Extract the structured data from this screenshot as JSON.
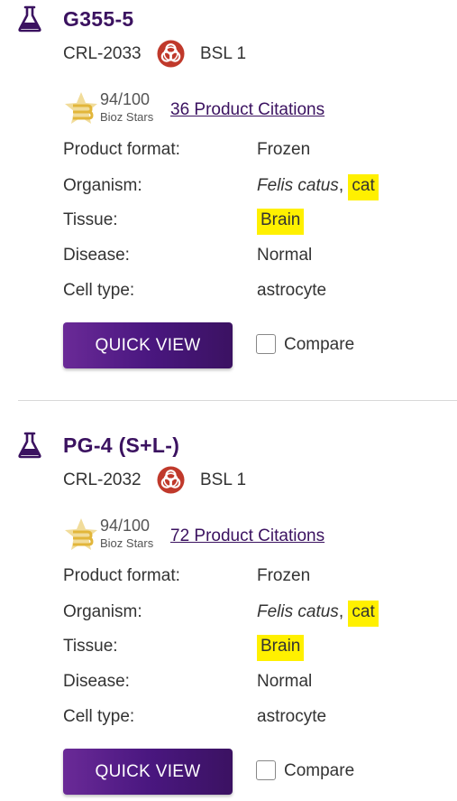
{
  "products": [
    {
      "name": "G355-5",
      "catalog": "CRL-2033",
      "biosafety": "BSL 1",
      "score": "94/100",
      "score_label": "Bioz Stars",
      "citations": "36 Product Citations",
      "properties": {
        "format_label": "Product format:",
        "format_value": "Frozen",
        "organism_label": "Organism:",
        "organism_species": "Felis catus",
        "organism_sep": ",",
        "organism_common": "cat",
        "tissue_label": "Tissue:",
        "tissue_value": "Brain",
        "disease_label": "Disease:",
        "disease_value": "Normal",
        "celltype_label": "Cell type:",
        "celltype_value": "astrocyte"
      },
      "quick_view_label": "QUICK VIEW",
      "compare_label": "Compare"
    },
    {
      "name": "PG-4 (S+L-)",
      "catalog": "CRL-2032",
      "biosafety": "BSL 1",
      "score": "94/100",
      "score_label": "Bioz Stars",
      "citations": "72 Product Citations",
      "properties": {
        "format_label": "Product format:",
        "format_value": "Frozen",
        "organism_label": "Organism:",
        "organism_species": "Felis catus",
        "organism_sep": ",",
        "organism_common": "cat",
        "tissue_label": "Tissue:",
        "tissue_value": "Brain",
        "disease_label": "Disease:",
        "disease_value": "Normal",
        "celltype_label": "Cell type:",
        "celltype_value": "astrocyte"
      },
      "quick_view_label": "QUICK VIEW",
      "compare_label": "Compare"
    }
  ],
  "icons": {
    "product": "flask-icon",
    "biosafety": "biohazard-icon",
    "rating": "bioz-star-logo"
  },
  "colors": {
    "title": "#3b1260",
    "button": "#4a1780",
    "highlight": "#fff000",
    "biohazard": "#c0392b",
    "star_gold": "#e8c547"
  }
}
